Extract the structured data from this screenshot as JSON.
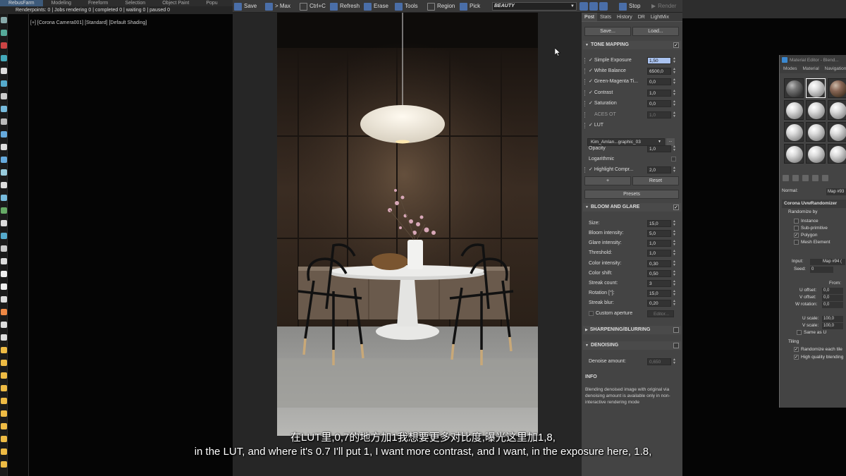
{
  "max": {
    "menu": [
      "RebusFarm",
      "Modeling",
      "Freeform",
      "Selection",
      "Object Paint",
      "Popu"
    ],
    "active_menu_index": 0,
    "status": "Renderpoints: 0 | Jobs rendering 0 | completed 0 | waiting 0 | paused 0",
    "viewport_label": "[+] [Corona Camera001] [Standard] [Default Shading]"
  },
  "vfb": {
    "toolbar": {
      "save": "Save",
      "max": "> Max",
      "copy": "Ctrl+C",
      "refresh": "Refresh",
      "erase": "Erase",
      "tools": "Tools",
      "region": "Region",
      "pick": "Pick",
      "channel": "BEAUTY",
      "stop": "Stop",
      "render": "Render"
    },
    "tabs": [
      "Post",
      "Stats",
      "History",
      "DR",
      "LightMix"
    ],
    "active_tab_index": 0,
    "save_button": "Save...",
    "load_button": "Load...",
    "tone_mapping": {
      "title": "TONE MAPPING",
      "enabled": true,
      "params": [
        {
          "label": "Simple Exposure",
          "value": "1,50",
          "checked": true,
          "highlighted": true
        },
        {
          "label": "White Balance",
          "value": "6500,0",
          "checked": true
        },
        {
          "label": "Green-Magenta Ti...",
          "value": "0,0",
          "checked": true
        },
        {
          "label": "Contrast",
          "value": "1,0",
          "checked": true
        },
        {
          "label": "Saturation",
          "value": "0,0",
          "checked": true
        },
        {
          "label": "ACES OT",
          "value": "1,0",
          "checked": false,
          "disabled": true
        },
        {
          "label": "LUT",
          "value": "",
          "checked": true
        }
      ],
      "lut_file": "Kim_Amlan...graphic_03",
      "lut_browse": "...",
      "opacity_label": "Opacity",
      "opacity_value": "1,0",
      "logarithmic_label": "Logarithmic",
      "highlight_label": "Highlight Compr...",
      "highlight_value": "2,0",
      "add_button": "+",
      "reset_button": "Reset",
      "presets_button": "Presets"
    },
    "bloom_glare": {
      "title": "BLOOM AND GLARE",
      "enabled": true,
      "params": [
        {
          "label": "Size:",
          "value": "15,0"
        },
        {
          "label": "Bloom intensity:",
          "value": "5,0"
        },
        {
          "label": "Glare intensity:",
          "value": "1,0"
        },
        {
          "label": "Threshold:",
          "value": "1,0"
        },
        {
          "label": "Color intensity:",
          "value": "0,30"
        },
        {
          "label": "Color shift:",
          "value": "0,50"
        },
        {
          "label": "Streak count:",
          "value": "3"
        },
        {
          "label": "Rotation [°]:",
          "value": "15,0"
        },
        {
          "label": "Streak blur:",
          "value": "0,20"
        }
      ],
      "custom_aperture_label": "Custom aperture",
      "editor_button": "Editor..."
    },
    "sharpening": {
      "title": "SHARPENING/BLURRING"
    },
    "denoising": {
      "title": "DENOISING",
      "amount_label": "Denoise amount:",
      "amount_value": "0,650"
    },
    "info": {
      "title": "INFO",
      "text": "Blending denoised image with original via denoising amount is available only in non-interactive rendering mode"
    }
  },
  "material_editor": {
    "title": "Material Editor - Blend...",
    "menu": [
      "Modes",
      "Material",
      "Navigation"
    ],
    "normal_label": "Normal:",
    "map_name": "Map #93",
    "rollout_title": "Corona UvwRandomizer",
    "randomize_by_label": "Randomize by",
    "randomize_options": [
      {
        "label": "Instance",
        "checked": false
      },
      {
        "label": "Sub-primitive",
        "checked": false
      },
      {
        "label": "Polygon",
        "checked": true
      },
      {
        "label": "Mesh Element",
        "checked": false
      }
    ],
    "input_label": "Input:",
    "input_value": "Map #94 (",
    "seed_label": "Seed:",
    "seed_value": "0",
    "from_label": "From:",
    "u_offset_label": "U offset:",
    "u_offset_value": "0,0",
    "v_offset_label": "V offset:",
    "v_offset_value": "0,0",
    "w_rotation_label": "W rotation:",
    "w_rotation_value": "0,0",
    "u_scale_label": "U scale:",
    "u_scale_value": "100,0",
    "v_scale_label": "V scale:",
    "v_scale_value": "100,0",
    "same_as_u_label": "Same as U",
    "tiling_label": "Tiling",
    "randomize_tile_label": "Randomize each tile",
    "high_quality_label": "High quality blending"
  },
  "subtitles": {
    "chinese": "在LUT里,0,7的地方加1我想要更多对比度,曝光这里加1,8,",
    "english": "in the LUT, and where it's 0.7 I'll put 1, I want more contrast, and I want, in the exposure here, 1.8,"
  },
  "colors": {
    "vfb_bg": "#2b2b2b",
    "panel_bg": "#444444",
    "highlight": "#aac3f0",
    "accent_blue": "#4a6ea8"
  }
}
